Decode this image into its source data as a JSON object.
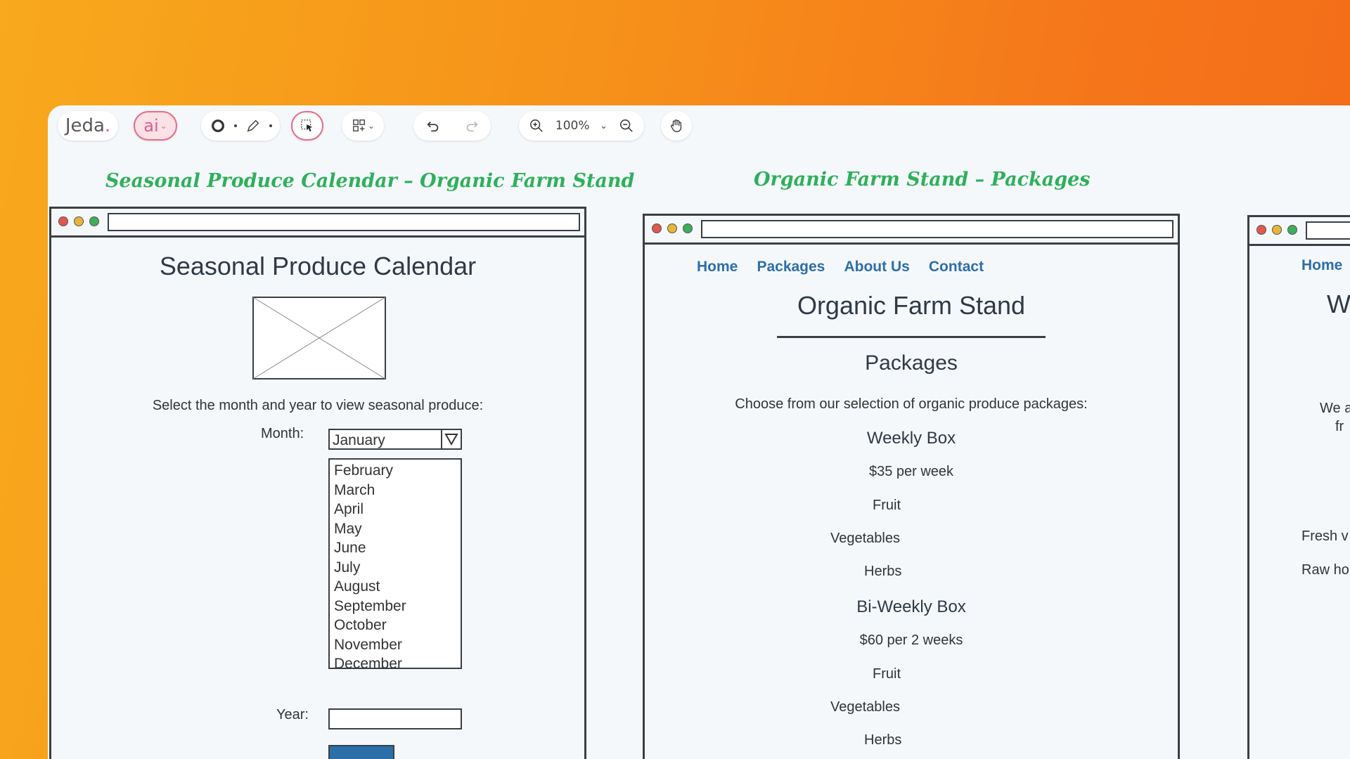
{
  "toolbar": {
    "logo": "Jeda",
    "logo_dot": ".",
    "ai_label": "ai",
    "zoom_level": "100%"
  },
  "frames": [
    {
      "title": "Seasonal Produce Calendar – Organic Farm Stand",
      "heading": "Seasonal Produce Calendar",
      "instruction": "Select the month and year to view seasonal produce:",
      "month_label": "Month:",
      "month_selected": "January",
      "months": [
        "February",
        "March",
        "April",
        "May",
        "June",
        "July",
        "August",
        "September",
        "October",
        "November",
        "December"
      ],
      "year_label": "Year:",
      "year_value": ""
    },
    {
      "title": "Organic Farm Stand – Packages",
      "nav": [
        "Home",
        "Packages",
        "About Us",
        "Contact"
      ],
      "site_name": "Organic Farm Stand",
      "section": "Packages",
      "intro": "Choose from our selection of organic produce packages:",
      "packages": [
        {
          "name": "Weekly Box",
          "price": "$35 per week",
          "items": [
            "Fruit",
            "Vegetables",
            "Herbs"
          ]
        },
        {
          "name": "Bi-Weekly Box",
          "price": "$60 per 2 weeks",
          "items": [
            "Fruit",
            "Vegetables",
            "Herbs"
          ]
        }
      ]
    },
    {
      "nav_first": "Home",
      "heading_partial": "W",
      "text_line1": "We a",
      "text_line2": "fr",
      "item1": "Fresh v",
      "item2": "Raw ho"
    }
  ],
  "colors": {
    "title_green": "#2fb05c",
    "link_blue": "#2c6fa8",
    "accent_pink": "#e86b87"
  }
}
